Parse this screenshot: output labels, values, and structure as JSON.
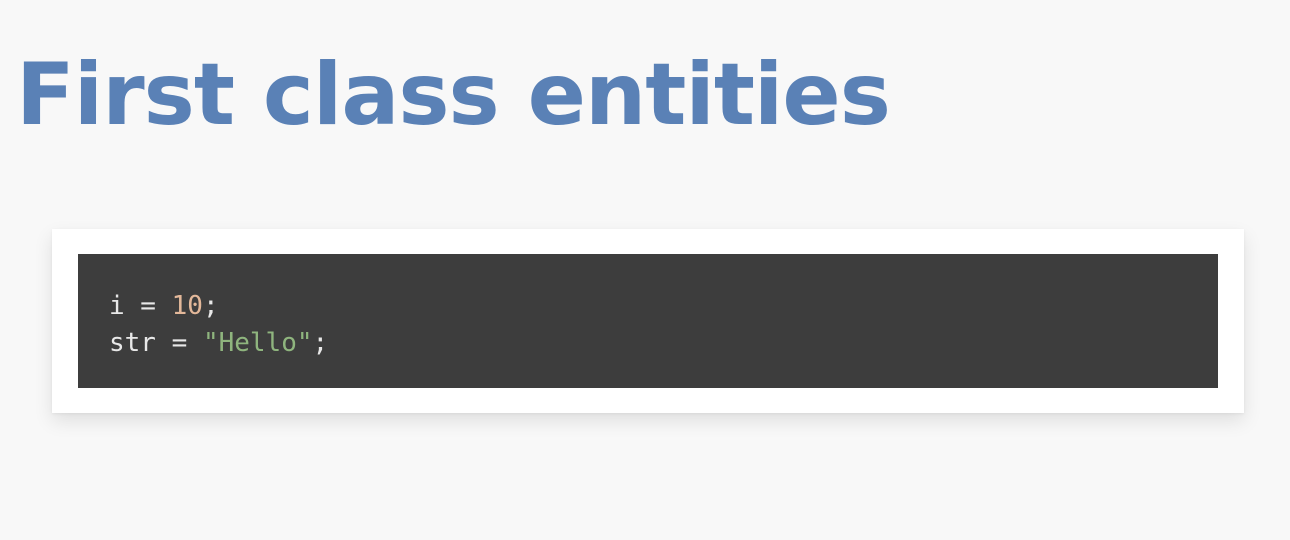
{
  "slide": {
    "title": "First class entities"
  },
  "code": {
    "line1": {
      "identifier": "i",
      "operator": " = ",
      "number": "10",
      "terminator": ";"
    },
    "line2": {
      "identifier": "str",
      "operator": " = ",
      "string": "\"Hello\"",
      "terminator": ";"
    }
  },
  "colors": {
    "title": "#5a81b6",
    "code_background": "#3d3d3d",
    "code_text": "#e8e8e8",
    "number_literal": "#e3b89a",
    "string_literal": "#8fb57e",
    "page_background": "#f8f8f8"
  }
}
